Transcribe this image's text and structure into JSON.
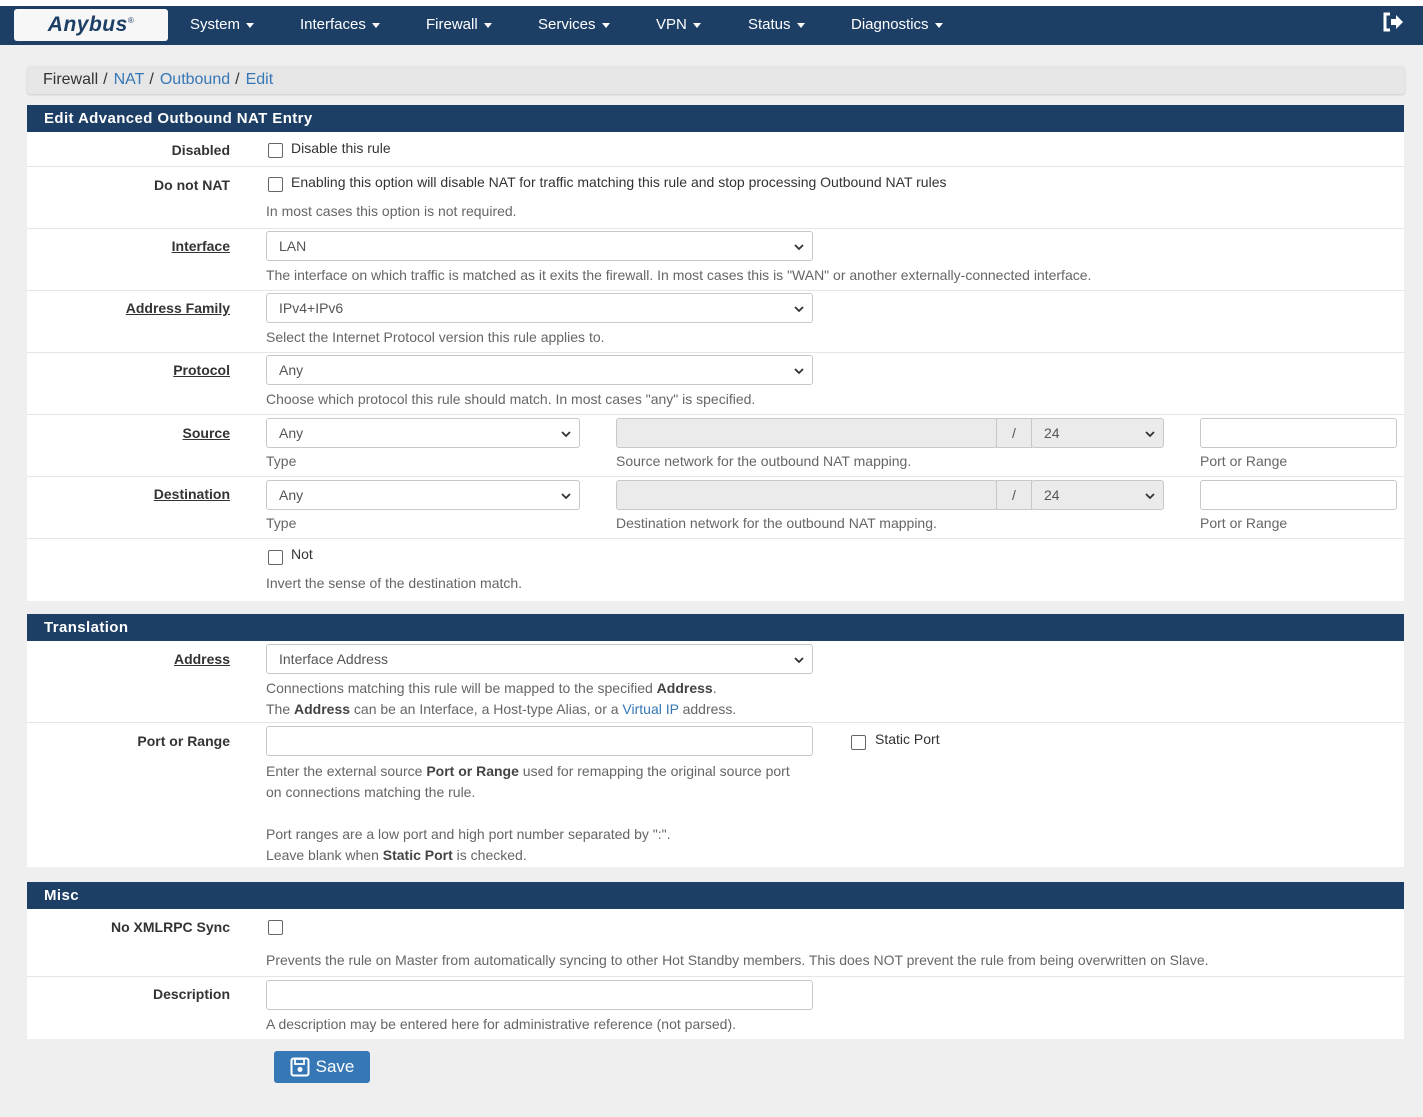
{
  "brand": {
    "name": "Anybus",
    "mark": "®"
  },
  "nav": [
    {
      "label": "System"
    },
    {
      "label": "Interfaces"
    },
    {
      "label": "Firewall"
    },
    {
      "label": "Services"
    },
    {
      "label": "VPN"
    },
    {
      "label": "Status"
    },
    {
      "label": "Diagnostics"
    }
  ],
  "breadcrumb": {
    "root": "Firewall",
    "sep": "/",
    "nat": "NAT",
    "outbound": "Outbound",
    "edit": "Edit"
  },
  "main": {
    "title": "Edit Advanced Outbound NAT Entry",
    "disabled": {
      "label": "Disabled",
      "checkbox_label": "Disable this rule",
      "checked": false
    },
    "donotnat": {
      "label": "Do not NAT",
      "checkbox_label": "Enabling this option will disable NAT for traffic matching this rule and stop processing Outbound NAT rules",
      "help": "In most cases this option is not required.",
      "checked": false
    },
    "interface": {
      "label": "Interface",
      "value": "LAN",
      "help": "The interface on which traffic is matched as it exits the firewall. In most cases this is \"WAN\" or another externally-connected interface."
    },
    "family": {
      "label": "Address Family",
      "value": "IPv4+IPv6",
      "help": "Select the Internet Protocol version this rule applies to."
    },
    "protocol": {
      "label": "Protocol",
      "value": "Any",
      "help": "Choose which protocol this rule should match. In most cases \"any\" is specified."
    },
    "source": {
      "label": "Source",
      "type_value": "Any",
      "type_help": "Type",
      "mask_sep": "/",
      "mask_value": "24",
      "network_help": "Source network for the outbound NAT mapping.",
      "port_help": "Port or Range"
    },
    "destination": {
      "label": "Destination",
      "type_value": "Any",
      "type_help": "Type",
      "mask_sep": "/",
      "mask_value": "24",
      "network_help": "Destination network for the outbound NAT mapping.",
      "port_help": "Port or Range"
    },
    "not": {
      "checkbox_label": "Not",
      "help": "Invert the sense of the destination match.",
      "checked": false
    }
  },
  "translation": {
    "title": "Translation",
    "address": {
      "label": "Address",
      "value": "Interface Address",
      "help1_pre": "Connections matching this rule will be mapped to the specified ",
      "help1_bold": "Address",
      "help1_post": ".",
      "help2_pre": "The ",
      "help2_bold": "Address",
      "help2_mid": " can be an Interface, a Host-type Alias, or a ",
      "help2_link": "Virtual IP",
      "help2_post": " address."
    },
    "port": {
      "label": "Port or Range",
      "static_label": "Static Port",
      "static_checked": false,
      "help1_pre": "Enter the external source ",
      "help1_bold": "Port or Range",
      "help1_post": " used for remapping the original source port",
      "help2": "on connections matching the rule.",
      "help3": "Port ranges are a low port and high port number separated by \":\".",
      "help4_pre": "Leave blank when ",
      "help4_bold": "Static Port",
      "help4_post": " is checked."
    }
  },
  "misc": {
    "title": "Misc",
    "xmlrpc": {
      "label": "No XMLRPC Sync",
      "help": "Prevents the rule on Master from automatically syncing to other Hot Standby members. This does NOT prevent the rule from being overwritten on Slave.",
      "checked": false
    },
    "description": {
      "label": "Description",
      "help": "A description may be entered here for administrative reference (not parsed)."
    }
  },
  "save_label": "Save",
  "colors": {
    "navbar": "#1d3f66",
    "link": "#3677b5",
    "button": "#3677b5",
    "panel_head": "#1d3f66"
  }
}
